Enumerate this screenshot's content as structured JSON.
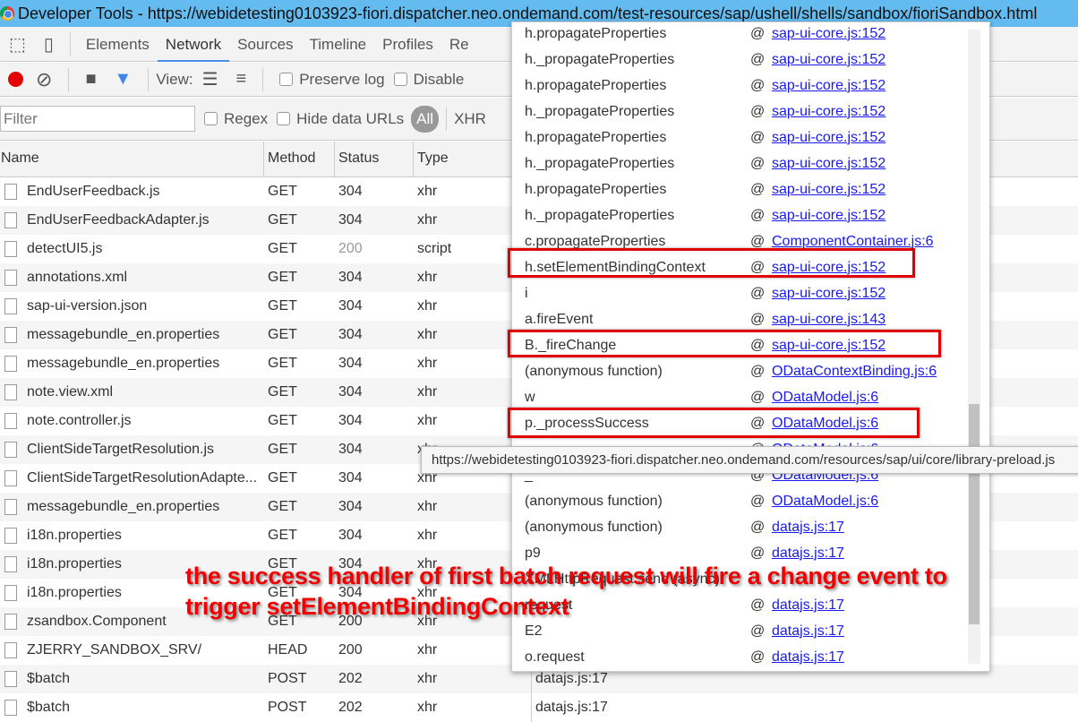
{
  "window": {
    "title": "Developer Tools - https://webidetesting0103923-fiori.dispatcher.neo.ondemand.com/test-resources/sap/ushell/shells/sandbox/fioriSandbox.html"
  },
  "tabs": [
    "Elements",
    "Network",
    "Sources",
    "Timeline",
    "Profiles",
    "Re"
  ],
  "toolbar": {
    "view_label": "View:",
    "preserve_log": "Preserve log",
    "disable_cache": "Disable"
  },
  "filterbar": {
    "placeholder": "Filter",
    "regex": "Regex",
    "hide_data_urls": "Hide data URLs",
    "all": "All",
    "xhr": "XHR"
  },
  "columns": [
    "Name",
    "Method",
    "Status",
    "Type"
  ],
  "rows": [
    {
      "name": "EndUserFeedback.js",
      "method": "GET",
      "status": "304",
      "type": "xhr",
      "initiator": ""
    },
    {
      "name": "EndUserFeedbackAdapter.js",
      "method": "GET",
      "status": "304",
      "type": "xhr",
      "initiator": ""
    },
    {
      "name": "detectUI5.js",
      "method": "GET",
      "status": "200",
      "type": "script",
      "initiator": ""
    },
    {
      "name": "annotations.xml",
      "method": "GET",
      "status": "304",
      "type": "xhr",
      "initiator": ""
    },
    {
      "name": "sap-ui-version.json",
      "method": "GET",
      "status": "304",
      "type": "xhr",
      "initiator": ""
    },
    {
      "name": "messagebundle_en.properties",
      "method": "GET",
      "status": "304",
      "type": "xhr",
      "initiator": ""
    },
    {
      "name": "messagebundle_en.properties",
      "method": "GET",
      "status": "304",
      "type": "xhr",
      "initiator": ""
    },
    {
      "name": "note.view.xml",
      "method": "GET",
      "status": "304",
      "type": "xhr",
      "initiator": ""
    },
    {
      "name": "note.controller.js",
      "method": "GET",
      "status": "304",
      "type": "xhr",
      "initiator": ""
    },
    {
      "name": "ClientSideTargetResolution.js",
      "method": "GET",
      "status": "304",
      "type": "xhr",
      "initiator": ""
    },
    {
      "name": "ClientSideTargetResolutionAdapte...",
      "method": "GET",
      "status": "304",
      "type": "xhr",
      "initiator": ""
    },
    {
      "name": "messagebundle_en.properties",
      "method": "GET",
      "status": "304",
      "type": "xhr",
      "initiator": ""
    },
    {
      "name": "i18n.properties",
      "method": "GET",
      "status": "304",
      "type": "xhr",
      "initiator": ""
    },
    {
      "name": "i18n.properties",
      "method": "GET",
      "status": "304",
      "type": "xhr",
      "initiator": ""
    },
    {
      "name": "i18n.properties",
      "method": "GET",
      "status": "304",
      "type": "xhr",
      "initiator": ""
    },
    {
      "name": "zsandbox.Component",
      "method": "GET",
      "status": "200",
      "type": "xhr",
      "initiator": ""
    },
    {
      "name": "ZJERRY_SANDBOX_SRV/",
      "method": "HEAD",
      "status": "200",
      "type": "xhr",
      "initiator": ""
    },
    {
      "name": "$batch",
      "method": "POST",
      "status": "202",
      "type": "xhr",
      "initiator": "datajs.js:17"
    },
    {
      "name": "$batch",
      "method": "POST",
      "status": "202",
      "type": "xhr",
      "initiator": "datajs.js:17"
    }
  ],
  "stack": [
    {
      "fn": "h.propagateProperties",
      "src": "sap-ui-core.js:152"
    },
    {
      "fn": "h._propagateProperties",
      "src": "sap-ui-core.js:152"
    },
    {
      "fn": "h.propagateProperties",
      "src": "sap-ui-core.js:152"
    },
    {
      "fn": "h._propagateProperties",
      "src": "sap-ui-core.js:152"
    },
    {
      "fn": "h.propagateProperties",
      "src": "sap-ui-core.js:152"
    },
    {
      "fn": "h._propagateProperties",
      "src": "sap-ui-core.js:152"
    },
    {
      "fn": "h.propagateProperties",
      "src": "sap-ui-core.js:152"
    },
    {
      "fn": "h._propagateProperties",
      "src": "sap-ui-core.js:152"
    },
    {
      "fn": "c.propagateProperties",
      "src": "ComponentContainer.js:6"
    },
    {
      "fn": "h.setElementBindingContext",
      "src": "sap-ui-core.js:152"
    },
    {
      "fn": "i",
      "src": "sap-ui-core.js:152"
    },
    {
      "fn": "a.fireEvent",
      "src": "sap-ui-core.js:143"
    },
    {
      "fn": "B._fireChange",
      "src": "sap-ui-core.js:152"
    },
    {
      "fn": "(anonymous function)",
      "src": "ODataContextBinding.js:6"
    },
    {
      "fn": "w",
      "src": "ODataModel.js:6"
    },
    {
      "fn": "p._processSuccess",
      "src": "ODataModel.js:6"
    },
    {
      "fn": "",
      "src": "ODataModel.js:6"
    },
    {
      "fn": "_",
      "src": "ODataModel.js:6"
    },
    {
      "fn": "(anonymous function)",
      "src": "ODataModel.js:6"
    },
    {
      "fn": "(anonymous function)",
      "src": "datajs.js:17"
    },
    {
      "fn": "p9",
      "src": "datajs.js:17"
    },
    {
      "fn": "XMLHttpRequest.send (async)",
      "src": ""
    },
    {
      "fn": "request",
      "src": "datajs.js:17"
    },
    {
      "fn": "E2",
      "src": "datajs.js:17"
    },
    {
      "fn": "o.request",
      "src": "datajs.js:17"
    }
  ],
  "tooltip": "https://webidetesting0103923-fiori.dispatcher.neo.ondemand.com/resources/sap/ui/core/library-preload.js",
  "annotation": {
    "line1": "the success handler of first batch request will fire a change event to",
    "line2": "trigger setElementBindingContext"
  },
  "colors": {
    "accent": "#4a8cf0",
    "highlight": "#e00000",
    "link": "#1a1aee"
  }
}
